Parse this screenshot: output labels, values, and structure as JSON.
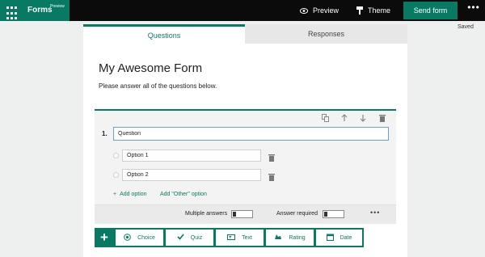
{
  "topbar": {
    "app_name": "Forms",
    "app_tag": "Preview",
    "preview_label": "Preview",
    "theme_label": "Theme",
    "send_label": "Send form",
    "more_label": "•••"
  },
  "status": {
    "saved": "Saved"
  },
  "tabs": [
    {
      "label": "Questions",
      "active": true
    },
    {
      "label": "Responses",
      "active": false
    }
  ],
  "form": {
    "title": "My Awesome Form",
    "description": "Please answer all of the questions below."
  },
  "question": {
    "number": "1.",
    "value": "Question",
    "options": [
      {
        "value": "Option 1"
      },
      {
        "value": "Option 2"
      }
    ],
    "add_option_label": "Add option",
    "add_other_label": "Add \"Other\" option",
    "multiple_answers_label": "Multiple answers",
    "answer_required_label": "Answer required",
    "more_label": "•••",
    "toolbar_icons": [
      "copy-icon",
      "arrow-up-icon",
      "arrow-down-icon",
      "trash-icon"
    ]
  },
  "add_bar": {
    "plus": "+",
    "types": [
      {
        "label": "Choice",
        "icon": "radio-icon"
      },
      {
        "label": "Quiz",
        "icon": "check-icon"
      },
      {
        "label": "Text",
        "icon": "text-icon"
      },
      {
        "label": "Rating",
        "icon": "rating-icon"
      },
      {
        "label": "Date",
        "icon": "calendar-icon"
      }
    ]
  },
  "colors": {
    "accent": "#087a63",
    "topbar": "#0b0b0b",
    "focus_border": "#6a9fd8",
    "background": "#eef0ef"
  }
}
